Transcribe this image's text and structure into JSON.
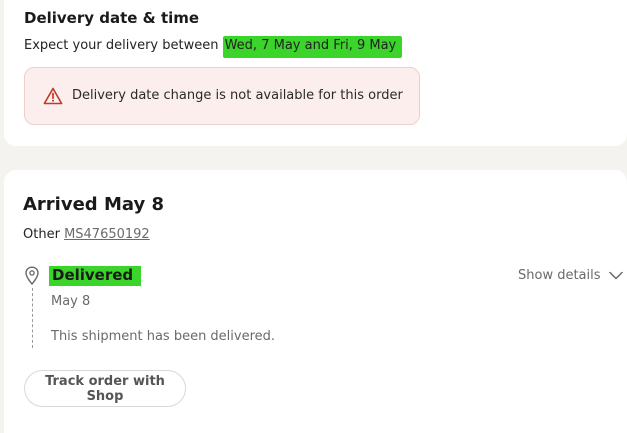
{
  "delivery_card": {
    "title": "Delivery date & time",
    "expect_prefix": "Expect your delivery between ",
    "expect_range": "Wed, 7 May and Fri, 9 May",
    "alert": {
      "icon": "warning-triangle-icon",
      "text": "Delivery date change is not available for this order",
      "icon_color": "#c0392b"
    }
  },
  "shipment_card": {
    "title": "Arrived May 8",
    "carrier": "Other",
    "tracking_number": "MS47650192",
    "status": {
      "icon": "location-pin-icon",
      "label": "Delivered",
      "date": "May 8",
      "description": "This shipment has been delivered."
    },
    "show_details_label": "Show details",
    "track_button_label": "Track order with Shop"
  },
  "colors": {
    "highlight": "#3bd42a",
    "alert_bg": "#fbeeed",
    "page_bg": "#f4f3f0"
  }
}
